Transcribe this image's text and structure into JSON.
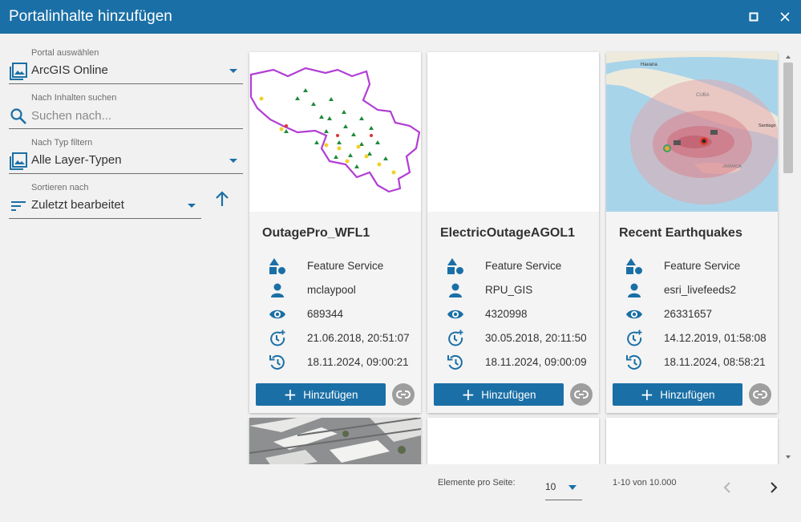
{
  "window": {
    "title": "Portalinhalte hinzufügen"
  },
  "filters": {
    "portal": {
      "label": "Portal auswählen",
      "value": "ArcGIS Online"
    },
    "search": {
      "label": "Nach Inhalten suchen",
      "placeholder": "Suchen nach..."
    },
    "type": {
      "label": "Nach Typ filtern",
      "value": "Alle Layer-Typen"
    },
    "sort": {
      "label": "Sortieren nach",
      "value": "Zuletzt bearbeitet"
    }
  },
  "cards": [
    {
      "title": "OutagePro_WFL1",
      "type": "Feature Service",
      "owner": "mclaypool",
      "views": "689344",
      "created": "21.06.2018, 20:51:07",
      "modified": "18.11.2024, 09:00:21",
      "add_label": "Hinzufügen"
    },
    {
      "title": "ElectricOutageAGOL1",
      "type": "Feature Service",
      "owner": "RPU_GIS",
      "views": "4320998",
      "created": "30.05.2018, 20:11:50",
      "modified": "18.11.2024, 09:00:09",
      "add_label": "Hinzufügen"
    },
    {
      "title": "Recent Earthquakes",
      "type": "Feature Service",
      "owner": "esri_livefeeds2",
      "views": "26331657",
      "created": "14.12.2019, 01:58:08",
      "modified": "18.11.2024, 08:58:21",
      "add_label": "Hinzufügen"
    }
  ],
  "map_labels": {
    "havana": "Havana",
    "cuba": "CUBA",
    "santiago": "Santiago",
    "jamaica": "JAMAICA"
  },
  "pagination": {
    "per_page_label": "Elemente pro Seite:",
    "per_page": "10",
    "range": "1-10 von 10.000"
  },
  "colors": {
    "primary": "#1a6fa6",
    "background": "#f1f1f1",
    "link_button": "#9e9e9e"
  }
}
